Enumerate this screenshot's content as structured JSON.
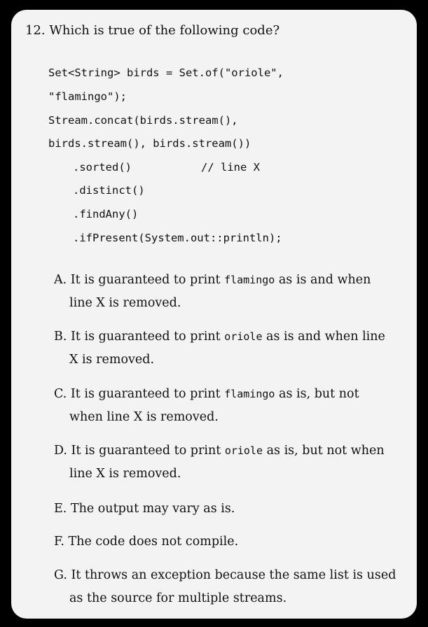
{
  "question": "12. Which is true of the following code?",
  "code": [
    "Set<String> birds = Set.of(\"oriole\",",
    "\"flamingo\");",
    "Stream.concat(birds.stream(),",
    "birds.stream(), birds.stream())",
    ".sorted()",
    "// line X",
    ".distinct()",
    ".findAny()",
    ".ifPresent(System.out::println);"
  ],
  "options": {
    "a": {
      "pre": "A. It is guaranteed to print ",
      "code": "flamingo",
      "post": " as is and when",
      "cont": "line X is removed."
    },
    "b": {
      "pre": "B. It is guaranteed to print ",
      "code": "oriole",
      "post": " as is and when line",
      "cont": "X is removed."
    },
    "c": {
      "pre": "C. It is guaranteed to print ",
      "code": "flamingo",
      "post": " as is, but not",
      "cont": "when line X is removed."
    },
    "d": {
      "pre": "D. It is guaranteed to print ",
      "code": "oriole",
      "post": " as is, but not when",
      "cont": "line X is removed."
    },
    "e": "E. The output may vary as is.",
    "f": "F. The code does not compile.",
    "g": {
      "line1": "G. It throws an exception because the same list is used",
      "cont": "as the source for multiple streams."
    }
  }
}
